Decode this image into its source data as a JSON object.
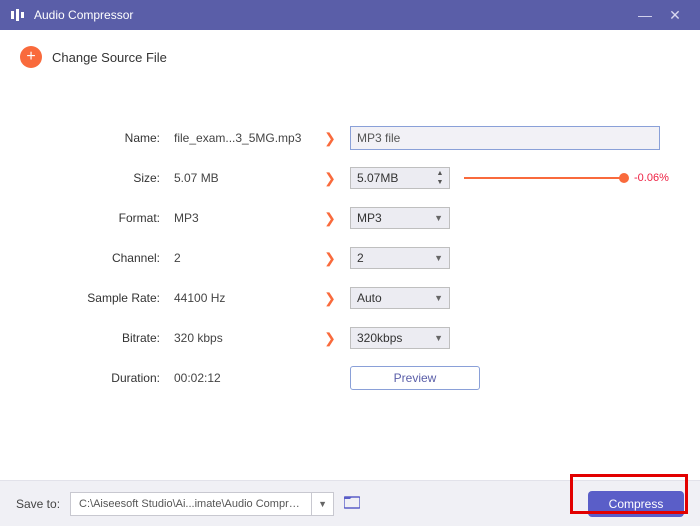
{
  "title": "Audio Compressor",
  "change_source": "Change Source File",
  "labels": {
    "name": "Name:",
    "size": "Size:",
    "format": "Format:",
    "channel": "Channel:",
    "sample_rate": "Sample Rate:",
    "bitrate": "Bitrate:",
    "duration": "Duration:"
  },
  "values": {
    "name": "file_exam...3_5MG.mp3",
    "size": "5.07 MB",
    "format": "MP3",
    "channel": "2",
    "sample_rate": "44100 Hz",
    "bitrate": "320 kbps",
    "duration": "00:02:12"
  },
  "controls": {
    "name_input": "MP3 file",
    "size_spinner": "5.07MB",
    "size_delta": "-0.06%",
    "format_select": "MP3",
    "channel_select": "2",
    "sample_rate_select": "Auto",
    "bitrate_select": "320kbps",
    "preview": "Preview"
  },
  "bottom": {
    "save_to_label": "Save to:",
    "path": "C:\\Aiseesoft Studio\\Ai...imate\\Audio Compressed",
    "compress": "Compress"
  }
}
